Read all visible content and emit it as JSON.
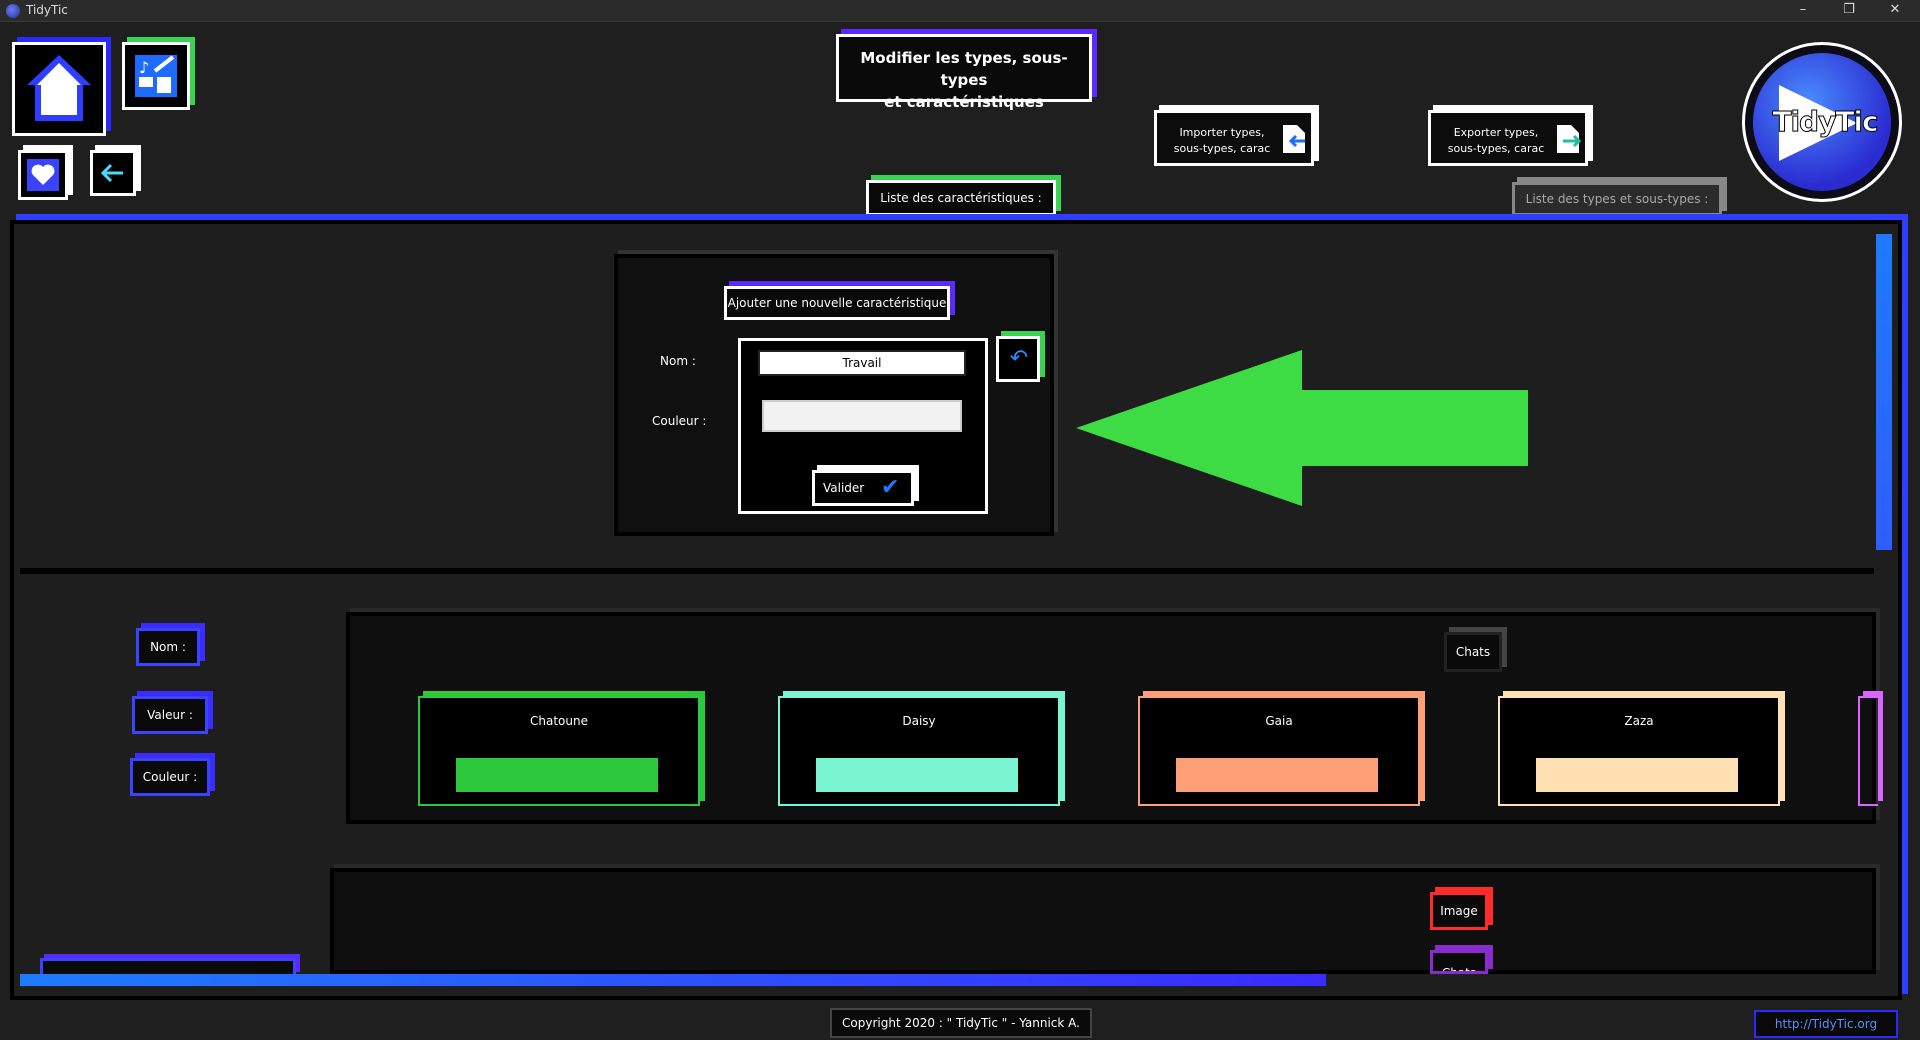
{
  "window": {
    "title": "TidyTic",
    "min_label": "–",
    "max_label": "❐",
    "close_label": "✕"
  },
  "header": {
    "title_line1": "Modifier les types, sous-types",
    "title_line2": "et caractéristiques",
    "import_line1": "Importer types,",
    "import_line2": "sous-types, carac",
    "export_line1": "Exporter types,",
    "export_line2": "sous-types, carac",
    "logo_text": "TidyTic"
  },
  "tabs": {
    "characteristics": "Liste des caractéristiques :",
    "types": "Liste des types et sous-types :"
  },
  "form": {
    "title": "Ajouter une nouvelle caractéristique",
    "name_label": "Nom :",
    "color_label": "Couleur :",
    "name_value": "Travail",
    "color_value": "",
    "validate_label": "Valider"
  },
  "legend": {
    "name": "Nom :",
    "value": "Valeur :",
    "color": "Couleur :"
  },
  "groups": [
    {
      "label": "Chats",
      "cards": [
        {
          "name": "Chatoune",
          "color": "#2ec83c"
        },
        {
          "name": "Daisy",
          "color": "#7af5d2"
        },
        {
          "name": "Gaia",
          "color": "#ff9f78"
        },
        {
          "name": "Zaza",
          "color": "#ffe1b4"
        }
      ]
    },
    {
      "tags": [
        "Image",
        "Chats"
      ]
    }
  ],
  "footer": {
    "copyright": "Copyright 2020 : \" TidyTic \" - Yannick A.",
    "link": "http://TidyTic.org"
  },
  "colors": {
    "accent": "#2f3dff",
    "highlight_arrow": "#3ddc44"
  }
}
